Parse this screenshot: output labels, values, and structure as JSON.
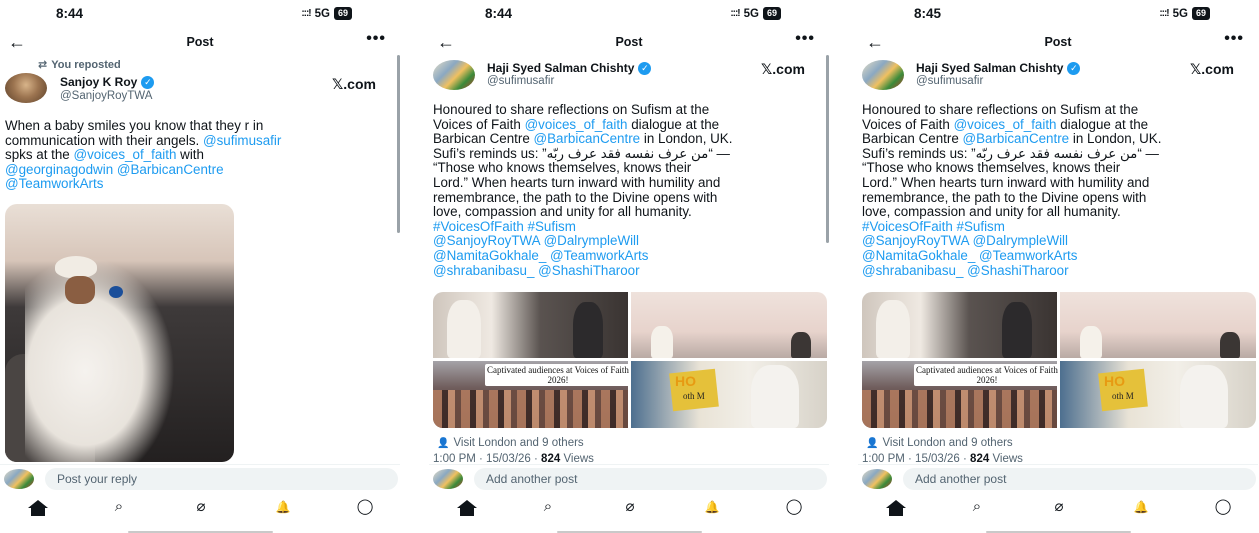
{
  "panels": [
    {
      "status": {
        "time": "8:44",
        "signal": ":::!",
        "network": "5G",
        "battery": "69"
      },
      "topbar": {
        "title": "Post"
      },
      "repost_label": "You reposted",
      "author": {
        "name": "Sanjoy K Roy",
        "handle": "@SanjoyRoyTWA"
      },
      "source": "𝕏.com",
      "text": {
        "line1": "When a baby smiles you know that they r in",
        "line2": "communication with their angels.",
        "m1": "@sufimusafir",
        "line3": "spks at the",
        "m2": "@voices_of_faith",
        "line3b": "with",
        "m3": "@georginagodwin",
        "m4": "@BarbicanCentre",
        "m5": "@TeamworkArts"
      },
      "reply_placeholder": "Post your reply"
    },
    {
      "status": {
        "time": "8:44",
        "signal": ":::!",
        "network": "5G",
        "battery": "69"
      },
      "topbar": {
        "title": "Post"
      },
      "author": {
        "name": "Haji Syed Salman Chishty",
        "handle": "@sufimusafir"
      },
      "source": "𝕏.com",
      "text": {
        "l1": "Honoured to share reflections on Sufism at the",
        "l2a": "Voices of Faith",
        "l2m": "@voices_of_faith",
        "l2b": "dialogue at the",
        "l3a": "Barbican Centre",
        "l3m": "@BarbicanCentre",
        "l3b": "in London, UK.",
        "l4a": "Sufi’s reminds us:",
        "l4q": "“من عرف نفسه فقد عرف ربّه”",
        "l4b": "—",
        "l5": "“Those who knows themselves, knows their",
        "l6": "Lord.” When hearts turn inward with humility and",
        "l7": "remembrance, the path to the Divine opens with",
        "l8": "love, compassion and unity for all humanity.",
        "tags": "#VoicesOfFaith #Sufism",
        "ml1": "@SanjoyRoyTWA @DalrympleWill",
        "ml2": "@NamitaGokhale_ @TeamworkArts",
        "ml3": "@shrabanibasu_ @ShashiTharoor"
      },
      "image_caption": "Captivated audiences at Voices of Faith 2026!",
      "book_title": "HO",
      "book_sub": "oth M",
      "reposts": "Visit London and 9 others",
      "timestamp": "1:00 PM · 15/03/26 ·",
      "views_count": "824",
      "views_label": "Views",
      "reply_placeholder": "Add another post"
    },
    {
      "status": {
        "time": "8:45",
        "signal": ":::!",
        "network": "5G",
        "battery": "69"
      },
      "topbar": {
        "title": "Post"
      },
      "author": {
        "name": "Haji Syed Salman Chishty",
        "handle": "@sufimusafir"
      },
      "source": "𝕏.com",
      "text": {
        "l1": "Honoured to share reflections on Sufism at the",
        "l2a": "Voices of Faith",
        "l2m": "@voices_of_faith",
        "l2b": "dialogue at the",
        "l3a": "Barbican Centre",
        "l3m": "@BarbicanCentre",
        "l3b": "in London, UK.",
        "l4a": "Sufi’s reminds us:",
        "l4q": "“من عرف نفسه فقد عرف ربّه”",
        "l4b": "—",
        "l5": "“Those who knows themselves, knows their",
        "l6": "Lord.” When hearts turn inward with humility and",
        "l7": "remembrance, the path to the Divine opens with",
        "l8": "love, compassion and unity for all humanity.",
        "tags": "#VoicesOfFaith #Sufism",
        "ml1": "@SanjoyRoyTWA @DalrympleWill",
        "ml2": "@NamitaGokhale_ @TeamworkArts",
        "ml3": "@shrabanibasu_ @ShashiTharoor"
      },
      "image_caption": "Captivated audiences at Voices of Faith 2026!",
      "book_title": "HO",
      "book_sub": "oth M",
      "reposts": "Visit London and 9 others",
      "timestamp": "1:00 PM · 15/03/26 ·",
      "views_count": "824",
      "views_label": "Views",
      "reply_placeholder": "Add another post"
    }
  ],
  "icons": {
    "back": "←",
    "more": "•••",
    "repost": "⇄",
    "verified": "✓",
    "person": "👤",
    "search": "⌕",
    "grok": "⌀",
    "bell": "🔔",
    "messages": "◯"
  },
  "colors": {
    "link": "#1d9bf0",
    "secondary": "#536471",
    "text": "#0f1419"
  }
}
